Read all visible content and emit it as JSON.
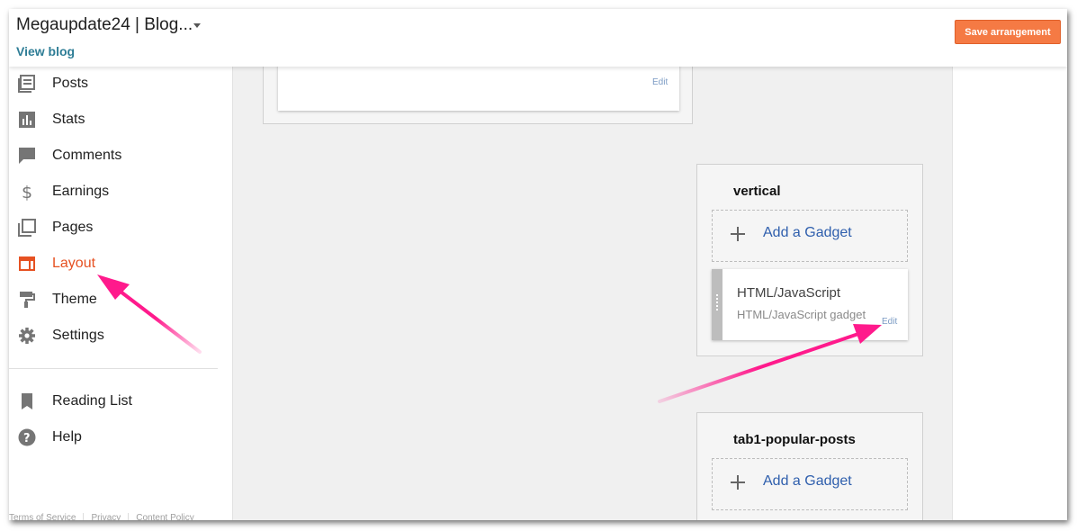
{
  "header": {
    "blog_title": "Megaupdate24 | Blog...",
    "view_blog": "View blog",
    "save_button": "Save arrangement"
  },
  "sidebar": {
    "items": [
      {
        "label": "Posts",
        "icon": "posts-icon"
      },
      {
        "label": "Stats",
        "icon": "stats-icon"
      },
      {
        "label": "Comments",
        "icon": "comments-icon"
      },
      {
        "label": "Earnings",
        "icon": "dollar-icon"
      },
      {
        "label": "Pages",
        "icon": "pages-icon"
      },
      {
        "label": "Layout",
        "icon": "layout-icon",
        "active": true
      },
      {
        "label": "Theme",
        "icon": "paint-roller-icon"
      },
      {
        "label": "Settings",
        "icon": "gear-icon"
      }
    ],
    "secondary_items": [
      {
        "label": "Reading List",
        "icon": "bookmark-icon"
      },
      {
        "label": "Help",
        "icon": "help-icon"
      }
    ],
    "footer_links": [
      "Terms of Service",
      "Privacy",
      "Content Policy"
    ]
  },
  "layout": {
    "top_gadget": {
      "edit_label": "Edit"
    },
    "sections": [
      {
        "title": "vertical",
        "add_gadget_label": "Add a Gadget",
        "gadgets": [
          {
            "title": "HTML/JavaScript",
            "subtitle": "HTML/JavaScript gadget",
            "edit_label": "Edit"
          }
        ]
      },
      {
        "title": "tab1-popular-posts",
        "add_gadget_label": "Add a Gadget"
      }
    ]
  },
  "colors": {
    "accent_orange": "#f57a44",
    "active_nav": "#e65122",
    "link_blue": "#2f5fad",
    "annotation_arrow": "#ff1a8c"
  }
}
